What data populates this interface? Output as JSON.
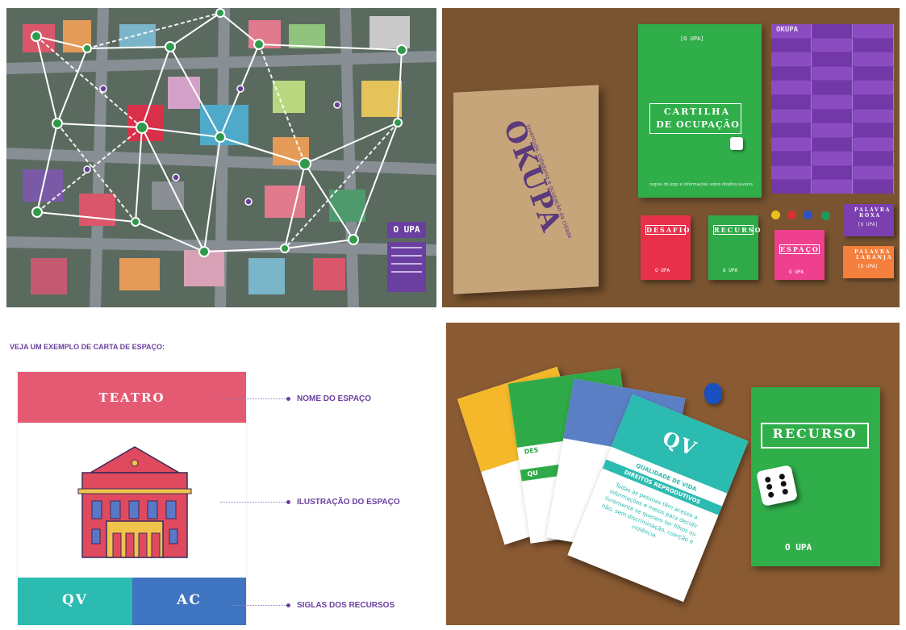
{
  "map_panel": {
    "badge_text": "O UPA",
    "legend_lines": [
      "",
      "",
      "",
      "",
      ""
    ]
  },
  "kit_panel": {
    "box_title": "OKUPA",
    "box_subtitle": "juventude, cidadania e ocupação da cidade",
    "booklet_logo": "[O UPA]",
    "booklet_title_1": "CARTILHA",
    "booklet_title_2": "DE OCUPAÇÃO",
    "booklet_footer": "regras do jogo e informações sobre direitos juvenis",
    "stack_label": "OKUPA",
    "decks": [
      {
        "label": "DESAFIO",
        "logo": "O UPA",
        "color": "#e8304a"
      },
      {
        "label": "RECURSO",
        "logo": "O UPA",
        "color": "#2faa48"
      },
      {
        "label": "ESPAÇO",
        "logo": "O UPA",
        "color": "#ef3f8f"
      }
    ],
    "small_decks": [
      {
        "label_1": "PALAVRA",
        "label_2": "ROXA",
        "logo": "[O UPA]",
        "color": "#7b3fb0"
      },
      {
        "label_1": "PALAVRA",
        "label_2": "LARANJA",
        "logo": "[O UPA]",
        "color": "#f57f3c"
      }
    ],
    "pawn_colors": [
      "#e8c21a",
      "#d93030",
      "#2a52c8",
      "#1f9a5a"
    ]
  },
  "card_panel": {
    "heading": "VEJA UM EXEMPLO DE CARTA DE ESPAÇO:",
    "card_title": "TEATRO",
    "code_left": "QV",
    "code_right": "AC",
    "annotations": [
      "NOME DO ESPAÇO",
      "ILUSTRAÇÃO DO ESPAÇO",
      "SIGLAS DOS RECURSOS"
    ],
    "colors": {
      "title_bar": "#e45a72",
      "left_code": "#2bbbb0",
      "right_code": "#3f74c0",
      "accent": "#6b3fa0"
    }
  },
  "cards_panel": {
    "front_card_code": "QV",
    "front_card_banner_1": "QUALIDADE DE VIDA",
    "front_card_banner_2": "DIREITOS REPRODUTIVOS",
    "front_card_text": "Todas as pessoas têm acesso a informações e meios para decidir livremente se querem ter filhos ou não, sem discriminação, coerção e violência.",
    "partial_label_1": "DES",
    "partial_label_2": "QU",
    "recurso_card_title": "RECURSO",
    "recurso_card_logo": "O UPA"
  }
}
